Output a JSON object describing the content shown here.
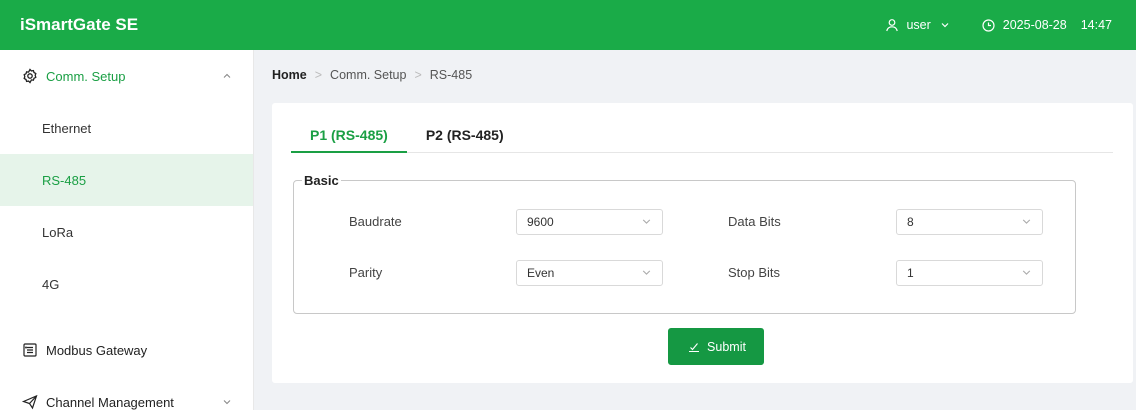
{
  "app": {
    "title": "iSmartGate SE"
  },
  "header": {
    "user": "user",
    "date": "2025-08-28",
    "time": "14:47"
  },
  "sidebar": {
    "group_comm": "Comm. Setup",
    "items": [
      {
        "label": "Ethernet"
      },
      {
        "label": "RS-485"
      },
      {
        "label": "LoRa"
      },
      {
        "label": "4G"
      }
    ],
    "group_modbus": "Modbus Gateway",
    "group_channel": "Channel Management"
  },
  "breadcrumb": {
    "home": "Home",
    "level1": "Comm. Setup",
    "level2": "RS-485"
  },
  "tabs": [
    {
      "label": "P1 (RS-485)"
    },
    {
      "label": "P2 (RS-485)"
    }
  ],
  "form": {
    "section_title": "Basic",
    "baudrate": {
      "label": "Baudrate",
      "value": "9600"
    },
    "data_bits": {
      "label": "Data Bits",
      "value": "8"
    },
    "parity": {
      "label": "Parity",
      "value": "Even"
    },
    "stop_bits": {
      "label": "Stop Bits",
      "value": "1"
    }
  },
  "submit_label": "Submit",
  "colors": {
    "brand": "#1aab48",
    "accent": "#1a9f44",
    "active_bg": "#e6f4ea"
  },
  "icons": [
    "user-icon",
    "clock-icon",
    "gear-icon",
    "chevron-up-icon",
    "chevron-down-icon",
    "gateway-icon",
    "send-icon",
    "submit-icon"
  ]
}
